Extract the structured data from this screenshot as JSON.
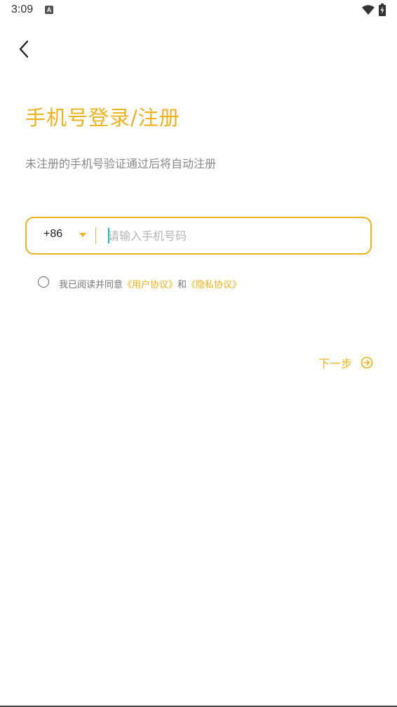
{
  "status_bar": {
    "time": "3:09",
    "notification_icon": "a-badge-icon",
    "wifi_icon": "wifi-icon",
    "battery_icon": "battery-charging-icon"
  },
  "nav": {
    "back_icon": "chevron-left-icon"
  },
  "header": {
    "title": "手机号登录/注册",
    "subtitle": "未注册的手机号验证通过后将自动注册"
  },
  "phone": {
    "country_code": "+86",
    "value": "",
    "placeholder": "请输入手机号码"
  },
  "agreement": {
    "prefix": "我已阅读并同意",
    "user_agreement": "《用户协议》",
    "conjunction": "和",
    "privacy_policy": "《隐私协议》"
  },
  "next": {
    "label": "下一步",
    "icon": "arrow-right-circle-icon"
  },
  "colors": {
    "accent": "#f0b21c",
    "caret": "#1ab9c4",
    "muted_text": "#888888"
  }
}
